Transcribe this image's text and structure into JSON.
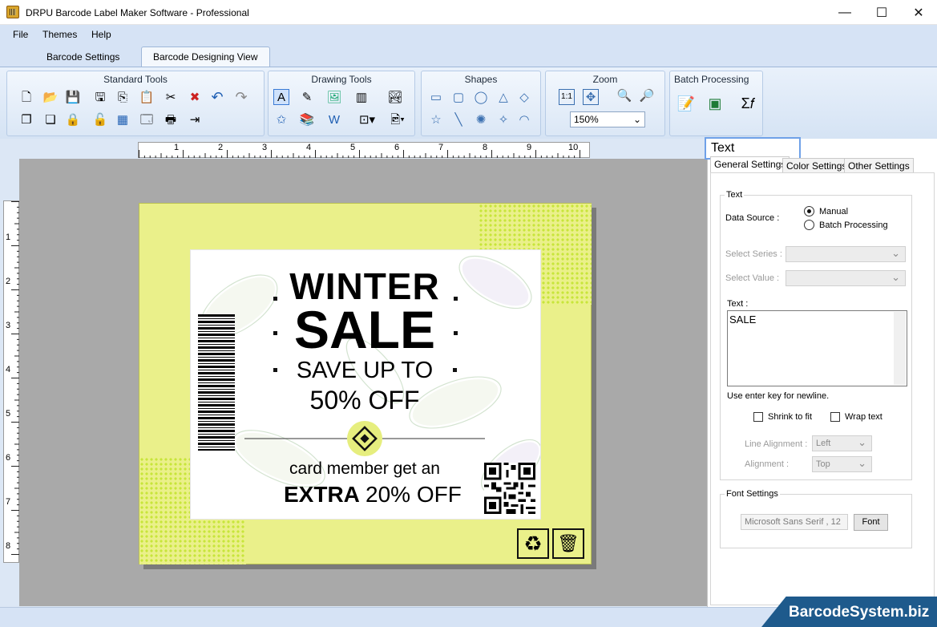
{
  "window": {
    "title": "DRPU Barcode Label Maker Software - Professional"
  },
  "menu": {
    "file": "File",
    "themes": "Themes",
    "help": "Help"
  },
  "tabs": {
    "barcode_settings": "Barcode Settings",
    "designing_view": "Barcode Designing View"
  },
  "ribbon": {
    "standard_tools": "Standard Tools",
    "drawing_tools": "Drawing Tools",
    "shapes": "Shapes",
    "zoom": "Zoom",
    "zoom_value": "150%",
    "batch_processing": "Batch Processing"
  },
  "rulers": {
    "horizontal": [
      "1",
      "2",
      "3",
      "4",
      "5",
      "6",
      "7",
      "8",
      "9",
      "10"
    ],
    "vertical": [
      "1",
      "2",
      "3",
      "4",
      "5",
      "6",
      "7",
      "8"
    ]
  },
  "label": {
    "line1": "WINTER",
    "line2": "SALE",
    "line3": "SAVE UP TO",
    "line4": "50% OFF",
    "line5": "card member get an",
    "line6_bold": "EXTRA",
    "line6_rest": "20% OFF"
  },
  "panel": {
    "title": "Text Properties",
    "tabs": {
      "general": "General Settings",
      "color": "Color Settings",
      "other": "Other Settings"
    },
    "text_group": "Text",
    "data_source_label": "Data Source :",
    "manual": "Manual",
    "batch": "Batch Processing",
    "select_series": "Select Series :",
    "select_value": "Select Value :",
    "text_label": "Text :",
    "text_value": "SALE",
    "hint": "Use enter key for newline.",
    "shrink": "Shrink to fit",
    "wrap": "Wrap text",
    "line_alignment_label": "Line Alignment :",
    "line_alignment_value": "Left",
    "alignment_label": "Alignment :",
    "alignment_value": "Top",
    "font_group": "Font Settings",
    "font_value": "Microsoft Sans Serif , 12",
    "font_button": "Font"
  },
  "brand": "BarcodeSystem.biz"
}
